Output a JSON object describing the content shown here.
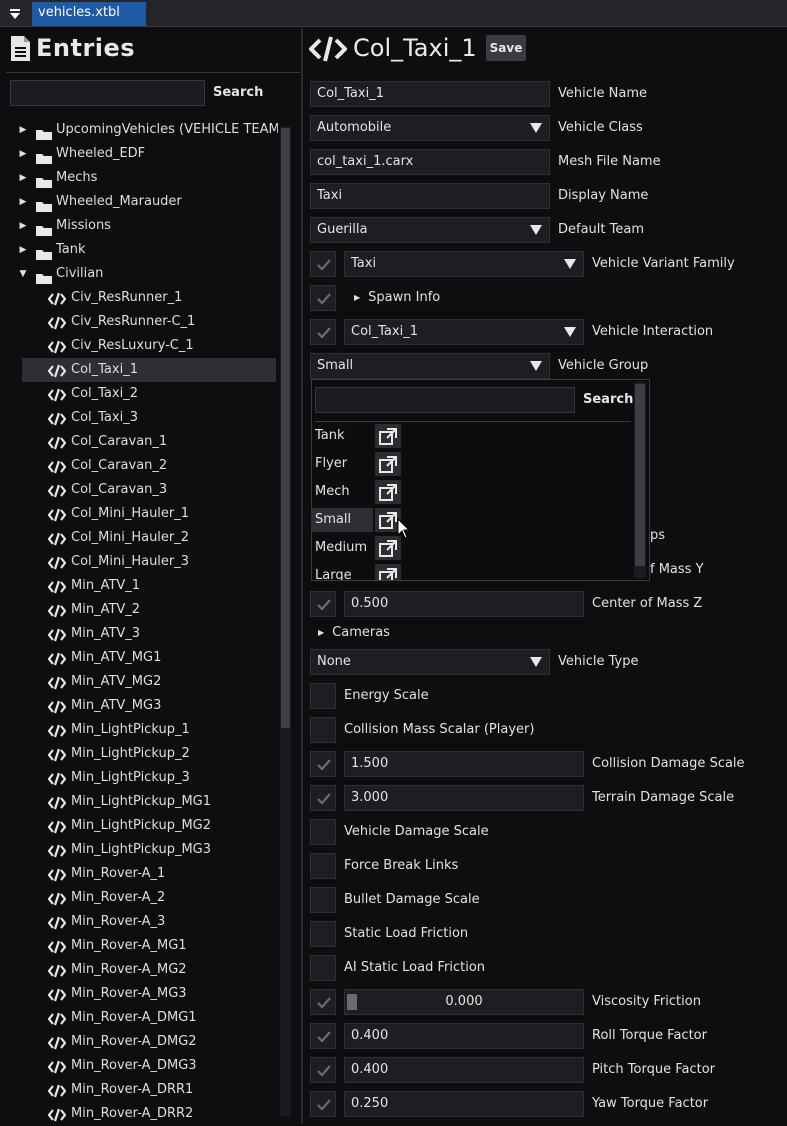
{
  "tab": {
    "label": "vehicles.xtbl"
  },
  "entries": {
    "title": "Entries",
    "search_placeholder": "",
    "search_label": "Search",
    "folders": [
      {
        "label": "UpcomingVehicles (VEHICLE TEAM ONLY)"
      },
      {
        "label": "Wheeled_EDF"
      },
      {
        "label": "Mechs"
      },
      {
        "label": "Wheeled_Marauder"
      },
      {
        "label": "Missions"
      },
      {
        "label": "Tank"
      },
      {
        "label": "Civilian"
      }
    ],
    "items": [
      "Civ_ResRunner_1",
      "Civ_ResRunner-C_1",
      "Civ_ResLuxury-C_1",
      "Col_Taxi_1",
      "Col_Taxi_2",
      "Col_Taxi_3",
      "Col_Caravan_1",
      "Col_Caravan_2",
      "Col_Caravan_3",
      "Col_Mini_Hauler_1",
      "Col_Mini_Hauler_2",
      "Col_Mini_Hauler_3",
      "Min_ATV_1",
      "Min_ATV_2",
      "Min_ATV_3",
      "Min_ATV_MG1",
      "Min_ATV_MG2",
      "Min_ATV_MG3",
      "Min_LightPickup_1",
      "Min_LightPickup_2",
      "Min_LightPickup_3",
      "Min_LightPickup_MG1",
      "Min_LightPickup_MG2",
      "Min_LightPickup_MG3",
      "Min_Rover-A_1",
      "Min_Rover-A_2",
      "Min_Rover-A_3",
      "Min_Rover-A_MG1",
      "Min_Rover-A_MG2",
      "Min_Rover-A_MG3",
      "Min_Rover-A_DMG1",
      "Min_Rover-A_DMG2",
      "Min_Rover-A_DMG3",
      "Min_Rover-A_DRR1",
      "Min_Rover-A_DRR2"
    ],
    "selected": "Col_Taxi_1"
  },
  "editor": {
    "title": "Col_Taxi_1",
    "save_label": "Save",
    "vehicle_name": {
      "value": "Col_Taxi_1",
      "label": "Vehicle Name"
    },
    "vehicle_class": {
      "value": "Automobile",
      "label": "Vehicle Class"
    },
    "mesh_file": {
      "value": "col_taxi_1.carx",
      "label": "Mesh File Name"
    },
    "display_name": {
      "value": "Taxi",
      "label": "Display Name"
    },
    "default_team": {
      "value": "Guerilla",
      "label": "Default Team"
    },
    "variant_family": {
      "value": "Taxi",
      "label": "Vehicle Variant Family",
      "checked": true
    },
    "spawn_info": {
      "label": "Spawn Info",
      "checked": true
    },
    "interaction": {
      "value": "Col_Taxi_1",
      "label": "Vehicle Interaction",
      "checked": true
    },
    "vehicle_group": {
      "value": "Small",
      "label": "Vehicle Group"
    },
    "partial_labels": {
      "a": "ps",
      "b": "f Mass Y"
    },
    "com_z": {
      "value": "0.500",
      "label": "Center of Mass Z",
      "checked": true
    },
    "cameras": {
      "label": "Cameras"
    },
    "vehicle_type": {
      "value": "None",
      "label": "Vehicle Type"
    },
    "energy_scale": {
      "label": "Energy Scale"
    },
    "collision_mass": {
      "label": "Collision Mass Scalar (Player)"
    },
    "collision_damage": {
      "value": "1.500",
      "label": "Collision Damage Scale",
      "checked": true
    },
    "terrain_damage": {
      "value": "3.000",
      "label": "Terrain Damage Scale",
      "checked": true
    },
    "vehicle_damage": {
      "label": "Vehicle Damage Scale"
    },
    "force_break": {
      "label": "Force Break Links"
    },
    "bullet_damage": {
      "label": "Bullet Damage Scale"
    },
    "static_friction": {
      "label": "Static Load Friction"
    },
    "ai_static_friction": {
      "label": "AI Static Load Friction"
    },
    "viscosity": {
      "value": "0.000",
      "label": "Viscosity Friction",
      "checked": true
    },
    "roll_torque": {
      "value": "0.400",
      "label": "Roll Torque Factor",
      "checked": true
    },
    "pitch_torque": {
      "value": "0.400",
      "label": "Pitch Torque Factor",
      "checked": true
    },
    "yaw_torque": {
      "value": "0.250",
      "label": "Yaw Torque Factor",
      "checked": true
    }
  },
  "group_popup": {
    "search_placeholder": "",
    "search_label": "Search",
    "options": [
      "Tank",
      "Flyer",
      "Mech",
      "Small",
      "Medium",
      "Large"
    ],
    "selected": "Small"
  },
  "colors": {
    "tab": "#1f5aa6",
    "background": "#0e0e11",
    "field": "#1e1e22",
    "selected_row": "#2e2e33"
  }
}
